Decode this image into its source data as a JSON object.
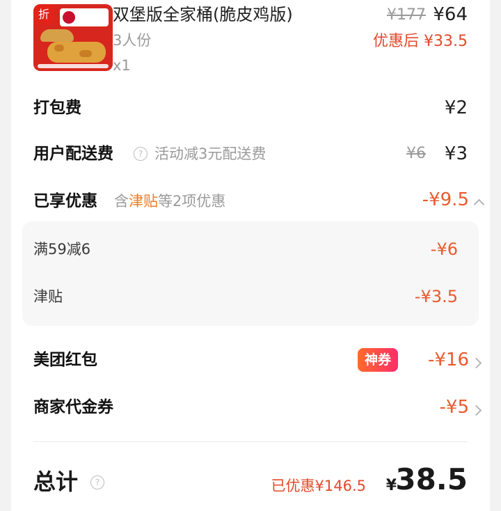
{
  "product": {
    "thumb_tag": "折",
    "title": "双堡版全家桶(脆皮鸡版)",
    "servings": "3人份",
    "quantity": "x1",
    "original_price": "¥177",
    "price": "¥64",
    "after_discount": "优惠后 ¥33.5"
  },
  "packing": {
    "label": "打包费",
    "value": "¥2"
  },
  "delivery": {
    "label": "用户配送费",
    "note": "活动减3元配送费",
    "original": "¥6",
    "value": "¥3"
  },
  "discounts": {
    "label": "已享优惠",
    "summary_prefix": "含",
    "summary_highlight": "津贴",
    "summary_suffix": "等2项优惠",
    "value": "-¥9.5",
    "items": [
      {
        "label": "满59减6",
        "value": "-¥6"
      },
      {
        "label": "津贴",
        "value": "-¥3.5"
      }
    ]
  },
  "red_packet": {
    "label": "美团红包",
    "badge": "神券",
    "value": "-¥16"
  },
  "voucher": {
    "label": "商家代金券",
    "value": "-¥5"
  },
  "total": {
    "label": "总计",
    "saved": "已优惠¥146.5",
    "currency": "¥",
    "amount": "38.5"
  },
  "colors": {
    "accent_red": "#ea5a2e",
    "badge_gradient_start": "#ff6a2a",
    "badge_gradient_end": "#ff2d6a"
  }
}
